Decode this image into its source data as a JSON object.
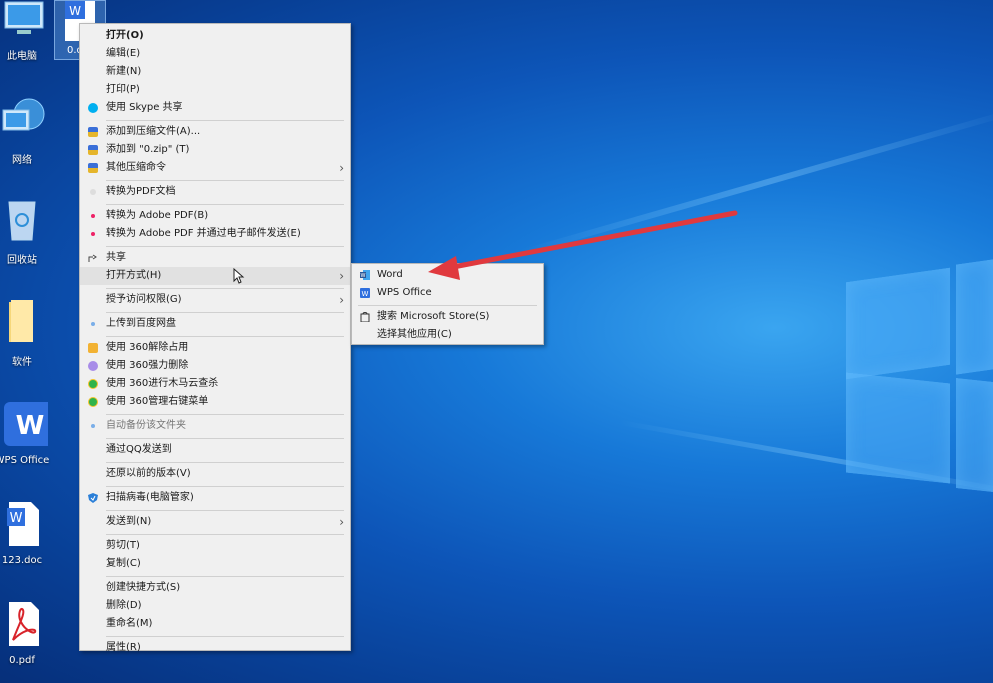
{
  "desktop": {
    "icons": [
      {
        "label": "此电脑",
        "icon": "computer-icon"
      },
      {
        "label": "网络",
        "icon": "network-icon"
      },
      {
        "label": "回收站",
        "icon": "recycle-bin-icon"
      },
      {
        "label": "软件",
        "icon": "folder-icon"
      },
      {
        "label": "WPS Office",
        "icon": "wps-office-icon"
      },
      {
        "label": "123.doc",
        "icon": "word-doc-icon"
      },
      {
        "label": "0.pdf",
        "icon": "pdf-icon"
      }
    ],
    "selected_file_label": "0.d"
  },
  "context_menu": {
    "items": [
      {
        "label": "打开(O)",
        "bold": true
      },
      {
        "label": "编辑(E)"
      },
      {
        "label": "新建(N)"
      },
      {
        "label": "打印(P)"
      },
      {
        "label": "使用 Skype 共享",
        "icon": "skype-icon"
      },
      {
        "label": "添加到压缩文件(A)...",
        "icon": "archive-icon"
      },
      {
        "label": "添加到 \"0.zip\" (T)",
        "icon": "archive-icon"
      },
      {
        "label": "其他压缩命令",
        "icon": "archive-icon",
        "arrow": true
      },
      {
        "label": "转换为PDF文档",
        "icon": "pdf-convert-icon"
      },
      {
        "label": "转换为 Adobe PDF(B)",
        "icon": "adobe-pdf-icon"
      },
      {
        "label": "转换为 Adobe PDF 并通过电子邮件发送(E)",
        "icon": "adobe-pdf-icon"
      },
      {
        "label": "共享",
        "icon": "share-icon"
      },
      {
        "label": "打开方式(H)",
        "arrow": true,
        "highlight": true
      },
      {
        "label": "授予访问权限(G)",
        "arrow": true
      },
      {
        "label": "上传到百度网盘",
        "icon": "baidu-cloud-icon"
      },
      {
        "label": "使用 360解除占用",
        "icon": "360-unlock-icon"
      },
      {
        "label": "使用 360强力删除",
        "icon": "360-delete-icon"
      },
      {
        "label": "使用 360进行木马云查杀",
        "icon": "360-scan-icon"
      },
      {
        "label": "使用 360管理右键菜单",
        "icon": "360-menu-icon"
      },
      {
        "label": "自动备份该文件夹",
        "icon": "backup-icon"
      },
      {
        "label": "通过QQ发送到"
      },
      {
        "label": "还原以前的版本(V)"
      },
      {
        "label": "扫描病毒(电脑管家)",
        "icon": "shield-icon"
      },
      {
        "label": "发送到(N)",
        "arrow": true
      },
      {
        "label": "剪切(T)"
      },
      {
        "label": "复制(C)"
      },
      {
        "label": "创建快捷方式(S)"
      },
      {
        "label": "删除(D)"
      },
      {
        "label": "重命名(M)"
      },
      {
        "label": "属性(R)"
      }
    ]
  },
  "open_with_submenu": {
    "items": [
      {
        "label": "Word",
        "icon": "word-icon"
      },
      {
        "label": "WPS Office",
        "icon": "wps-icon"
      },
      {
        "label": "搜索 Microsoft Store(S)",
        "icon": "store-icon"
      },
      {
        "label": "选择其他应用(C)"
      }
    ]
  },
  "colors": {
    "accent_arrow": "#e0393e",
    "word_blue": "#2b5797",
    "wps_blue": "#2f6fde"
  }
}
